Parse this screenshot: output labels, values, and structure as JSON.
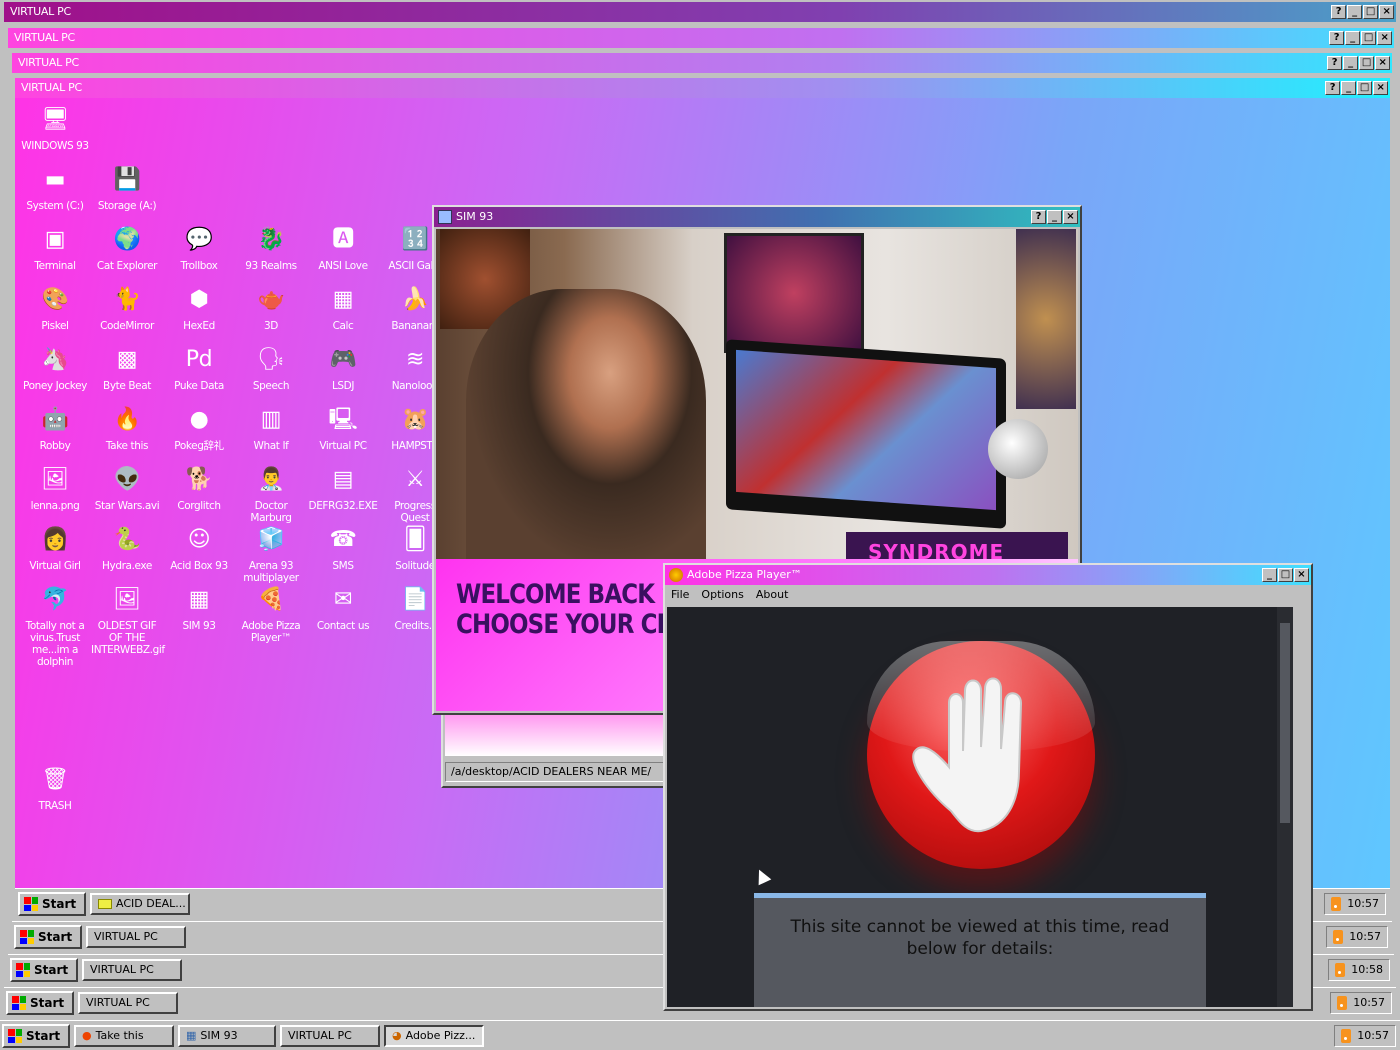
{
  "frames": [
    {
      "title": "VIRTUAL PC",
      "task_label": "VIRTUAL PC",
      "clock": "10:57"
    },
    {
      "title": "VIRTUAL PC",
      "task_label": "VIRTUAL PC",
      "clock": "10:58"
    },
    {
      "title": "VIRTUAL PC",
      "task_label": "VIRTUAL PC",
      "clock": "10:57"
    },
    {
      "title": "VIRTUAL PC",
      "task_label": "ACID DEAL...",
      "clock": "10:57"
    }
  ],
  "title_buttons": {
    "help": "?",
    "min": "_",
    "max": "□",
    "close": "×"
  },
  "start_label": "Start",
  "desktop_icons": [
    {
      "label": "WINDOWS 93",
      "glyph": "🖥"
    },
    {
      "label": "System (C:)",
      "glyph": "▬"
    },
    {
      "label": "Storage (A:)",
      "glyph": "💾"
    },
    {
      "label": "Terminal",
      "glyph": "▣"
    },
    {
      "label": "Cat Explorer",
      "glyph": "🌍"
    },
    {
      "label": "Trollbox",
      "glyph": "💬"
    },
    {
      "label": "93 Realms",
      "glyph": "🐉"
    },
    {
      "label": "ANSI Love",
      "glyph": "🅰"
    },
    {
      "label": "ASCII Galle",
      "glyph": "🔢"
    },
    {
      "label": "Piskel",
      "glyph": "🎨"
    },
    {
      "label": "CodeMirror",
      "glyph": "🐈"
    },
    {
      "label": "HexEd",
      "glyph": "⬢"
    },
    {
      "label": "3D",
      "glyph": "🫖"
    },
    {
      "label": "Calc",
      "glyph": "▦"
    },
    {
      "label": "Bananam",
      "glyph": "🍌"
    },
    {
      "label": "Poney Jockey",
      "glyph": "🦄"
    },
    {
      "label": "Byte Beat",
      "glyph": "▩"
    },
    {
      "label": "Puke Data",
      "glyph": "Pd"
    },
    {
      "label": "Speech",
      "glyph": "🗣"
    },
    {
      "label": "LSDJ",
      "glyph": "🎮"
    },
    {
      "label": "Nanoloop",
      "glyph": "≋"
    },
    {
      "label": "Robby",
      "glyph": "🤖"
    },
    {
      "label": "Take this",
      "glyph": "🔥"
    },
    {
      "label": "Pokeg辞礼",
      "glyph": "●"
    },
    {
      "label": "What If",
      "glyph": "▥"
    },
    {
      "label": "Virtual PC",
      "glyph": "🖳"
    },
    {
      "label": "HAMPSTE",
      "glyph": "🐹"
    },
    {
      "label": "lenna.png",
      "glyph": "🖼"
    },
    {
      "label": "Star Wars.avi",
      "glyph": "👽"
    },
    {
      "label": "Corglitch",
      "glyph": "🐕"
    },
    {
      "label": "Doctor Marburg",
      "glyph": "👨‍⚕"
    },
    {
      "label": "DEFRG32.EXE",
      "glyph": "▤"
    },
    {
      "label": "Progress Quest",
      "glyph": "⚔"
    },
    {
      "label": "Virtual Girl",
      "glyph": "👩"
    },
    {
      "label": "Hydra.exe",
      "glyph": "🐍"
    },
    {
      "label": "Acid Box 93",
      "glyph": "☺"
    },
    {
      "label": "Arena 93 multiplayer",
      "glyph": "🧊"
    },
    {
      "label": "SMS",
      "glyph": "☎"
    },
    {
      "label": "Solitude",
      "glyph": "🂠"
    },
    {
      "label": "Totally not a virus.Trust me...im a dolphin",
      "glyph": "🐬"
    },
    {
      "label": "OLDEST GIF OF THE INTERWEBZ.gif",
      "glyph": "🖼"
    },
    {
      "label": "SIM 93",
      "glyph": "▦"
    },
    {
      "label": "Adobe Pizza Player™",
      "glyph": "🍕"
    },
    {
      "label": "Contact us",
      "glyph": "✉"
    },
    {
      "label": "Credits.t",
      "glyph": "📄"
    },
    {
      "label": "TRASH",
      "glyph": "🗑"
    }
  ],
  "sim93": {
    "title": "SIM 93",
    "banner_line1": "WELCOME BACK ST",
    "banner_line2": "CHOOSE YOUR CHA",
    "overlay_text": "SYNDROME WRW"
  },
  "explorer": {
    "path": "/a/desktop/ACID DEALERS NEAR ME/"
  },
  "pizza": {
    "title": "Adobe Pizza Player™",
    "menu": [
      "File",
      "Options",
      "About"
    ],
    "message": "This site cannot be viewed at this time, read below for details:"
  },
  "main_taskbar": {
    "items": [
      "Take this",
      "SIM 93",
      "VIRTUAL PC",
      "Adobe Pizz..."
    ],
    "clock": "10:57"
  }
}
